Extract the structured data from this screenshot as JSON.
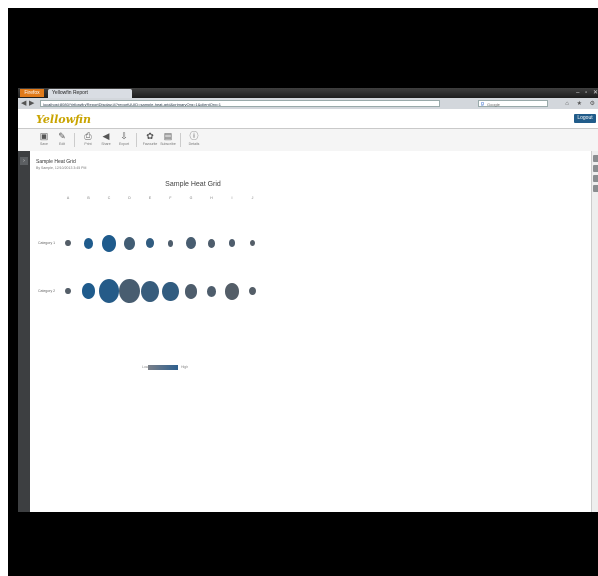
{
  "browser": {
    "app_button": "Firefox",
    "tab_title": "Yellowfin Report",
    "url": "localhost:8080/Yellowfin/ReportDisplay.i4?reportUUID=sample-heat-grid&primaryOrg=1&clientOrg=1",
    "search_placeholder": "Google",
    "window_controls": "– ▫ ✕"
  },
  "app": {
    "logo": "Yellowfin",
    "header_button": "Logout"
  },
  "toolbar": {
    "items": [
      {
        "icon": "save-icon",
        "glyph": "▣",
        "label": "Save"
      },
      {
        "icon": "edit-icon",
        "glyph": "✎",
        "label": "Edit"
      },
      {
        "icon": "print-icon",
        "glyph": "⎙",
        "label": "Print"
      },
      {
        "icon": "share-icon",
        "glyph": "◀",
        "label": "Share"
      },
      {
        "icon": "export-icon",
        "glyph": "⇩",
        "label": "Export"
      },
      {
        "icon": "add-favourite-icon",
        "glyph": "✿",
        "label": "Favourite"
      },
      {
        "icon": "subscribe-icon",
        "glyph": "▤",
        "label": "Subscribe"
      },
      {
        "icon": "info-icon",
        "glyph": "ⓘ",
        "label": "Details"
      }
    ]
  },
  "report": {
    "title": "Sample Heat Grid",
    "meta": "By Sample, 12/10/2013 3:45 PM"
  },
  "chart_data": {
    "type": "heatmap",
    "title": "Sample Heat Grid",
    "columns": [
      "A",
      "B",
      "C",
      "D",
      "E",
      "F",
      "G",
      "H",
      "I",
      "J"
    ],
    "rows": [
      {
        "name": "Category 1",
        "sizes": [
          0.1,
          0.35,
          0.65,
          0.45,
          0.3,
          0.15,
          0.42,
          0.25,
          0.2,
          0.1
        ],
        "intensity": [
          0.1,
          1.0,
          1.0,
          0.4,
          0.7,
          0.2,
          0.3,
          0.2,
          0.2,
          0.1
        ]
      },
      {
        "name": "Category 2",
        "sizes": [
          0.1,
          0.62,
          1.0,
          1.0,
          0.85,
          0.75,
          0.55,
          0.35,
          0.65,
          0.2
        ],
        "intensity": [
          0.1,
          1.0,
          0.9,
          0.3,
          0.6,
          0.7,
          0.2,
          0.2,
          0.1,
          0.1
        ]
      }
    ],
    "legend": {
      "low": "Low",
      "high": "High"
    },
    "colors": {
      "low": "#5a5e64",
      "high": "#1f5b8c"
    }
  }
}
